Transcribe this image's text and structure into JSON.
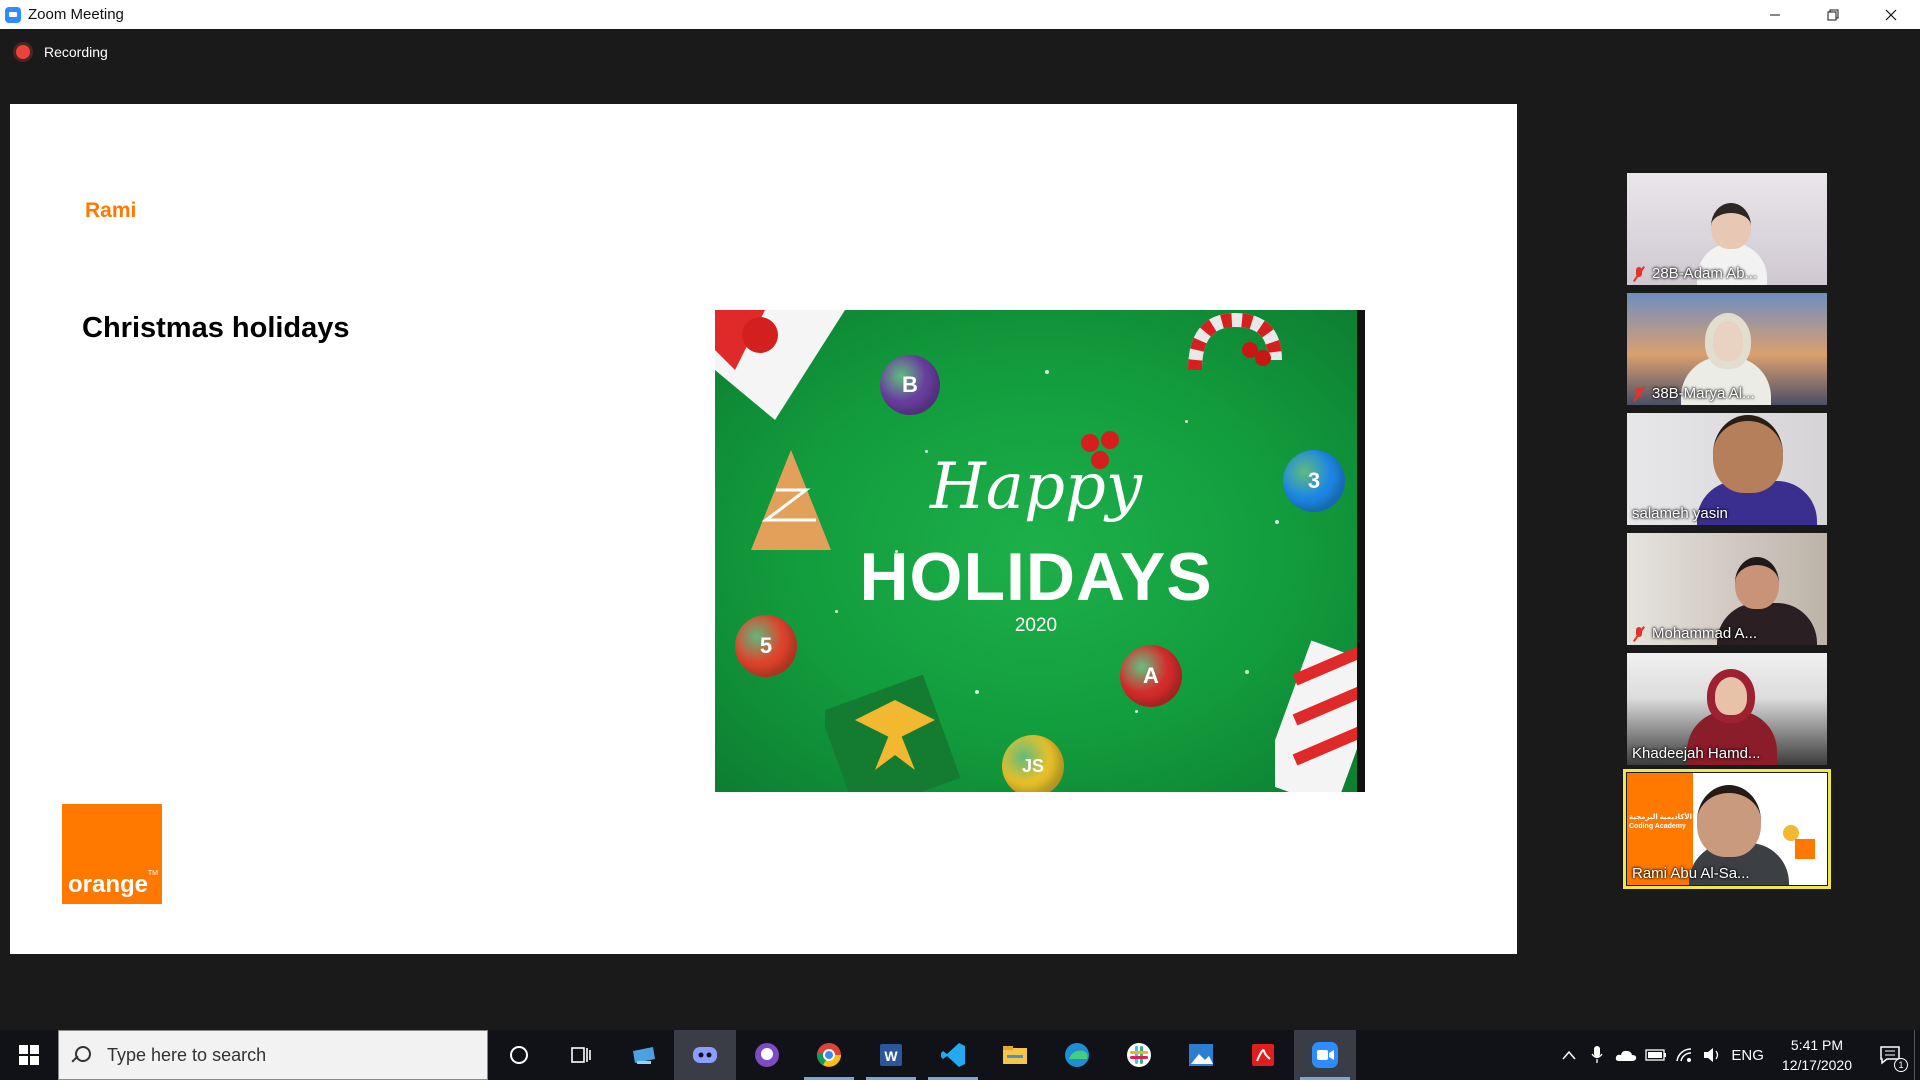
{
  "window": {
    "title": "Zoom Meeting",
    "controls": [
      "minimize",
      "restore",
      "close"
    ]
  },
  "recording": {
    "label": "Recording"
  },
  "slide": {
    "presenter_name": "Rami",
    "title": "Christmas holidays",
    "image": {
      "script_text": "Happy",
      "headline": "HOLIDAYS",
      "year": "2020",
      "ornaments": [
        {
          "icon": "bootstrap-icon",
          "text": "B",
          "color": "#6a3fa0"
        },
        {
          "icon": "css3-icon",
          "text": "3",
          "color": "#1e88e5"
        },
        {
          "icon": "html5-icon",
          "text": "5",
          "color": "#e0442c"
        },
        {
          "icon": "angular-icon",
          "text": "A",
          "color": "#d62d2d"
        },
        {
          "icon": "javascript-icon",
          "text": "JS",
          "color": "#e8c12a"
        }
      ]
    },
    "brand": {
      "name": "orange",
      "trademark": "TM",
      "color": "#ff7900"
    }
  },
  "participants": [
    {
      "name": "28B-Adam Ab...",
      "muted": true,
      "active": false
    },
    {
      "name": "38B-Marya Al...",
      "muted": true,
      "active": false
    },
    {
      "name": "salameh yasin",
      "muted": false,
      "active": false
    },
    {
      "name": "Mohammad A...",
      "muted": true,
      "active": false
    },
    {
      "name": "Khadeejah Hamd...",
      "muted": false,
      "active": false
    },
    {
      "name": "Rami Abu Al-Sa...",
      "muted": false,
      "active": true,
      "background_text": [
        "الأكاديمية البرمجية",
        "Coding Academy"
      ]
    }
  ],
  "taskbar": {
    "search_placeholder": "Type here to search",
    "apps": [
      "cortana-icon",
      "task-view-icon",
      "network-app-icon",
      "discord-icon",
      "github-desktop-icon",
      "chrome-icon",
      "word-icon",
      "vscode-icon",
      "file-explorer-icon",
      "edge-icon",
      "slack-icon",
      "photos-icon",
      "acrobat-icon",
      "zoom-icon"
    ],
    "tray": {
      "language": "ENG",
      "time": "5:41 PM",
      "date": "12/17/2020",
      "notification_count": "1"
    }
  }
}
